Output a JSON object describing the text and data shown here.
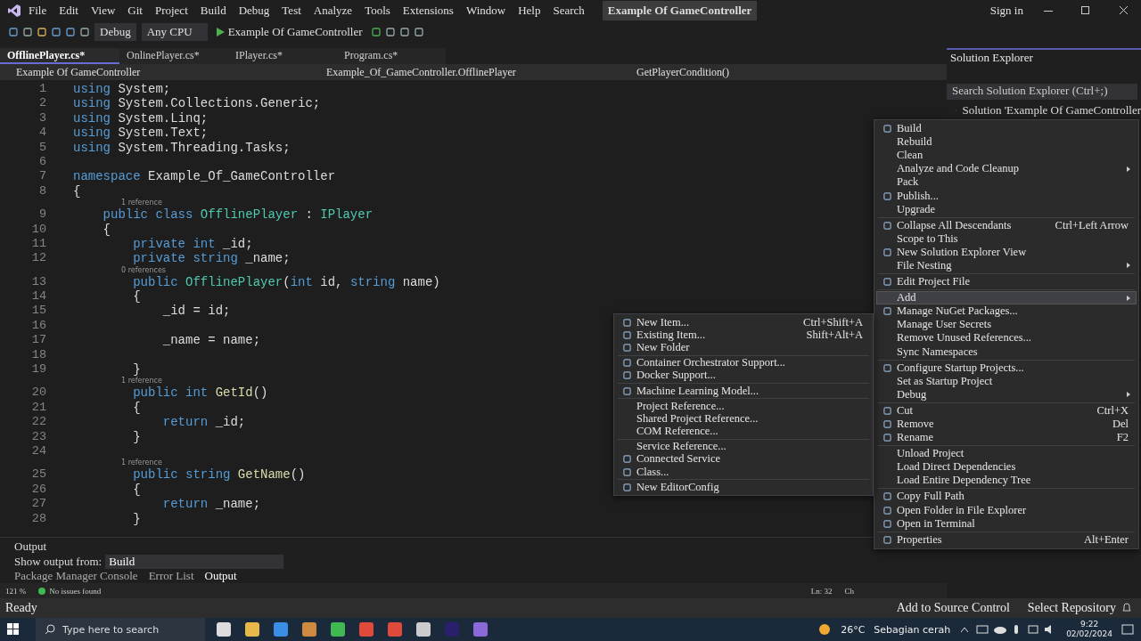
{
  "menu_bar": {
    "items": [
      "File",
      "Edit",
      "View",
      "Git",
      "Project",
      "Build",
      "Debug",
      "Test",
      "Analyze",
      "Tools",
      "Extensions",
      "Window",
      "Help"
    ],
    "search": "Search",
    "title": "Example Of GameController",
    "sign_in": "Sign in"
  },
  "toolbar": {
    "configuration": "Debug",
    "platform": "Any CPU",
    "start": "Example Of GameController"
  },
  "tabs": [
    {
      "label": "OfflinePlayer.cs*",
      "selected": true
    },
    {
      "label": "OnlinePlayer.cs*",
      "selected": false
    },
    {
      "label": "IPlayer.cs*",
      "selected": false
    },
    {
      "label": "Program.cs*",
      "selected": false
    }
  ],
  "navigation": {
    "project": "Example Of GameController",
    "type": "Example_Of_GameController.OfflinePlayer",
    "member": "GetPlayerCondition()"
  },
  "code": [
    {
      "num": "1",
      "segs": [
        {
          "kind": "keyword",
          "t": "using"
        },
        {
          "kind": "plain",
          "t": " System;"
        }
      ]
    },
    {
      "num": "2",
      "segs": [
        {
          "kind": "keyword",
          "t": "using"
        },
        {
          "kind": "plain",
          "t": " System.Collections.Generic;"
        }
      ]
    },
    {
      "num": "3",
      "segs": [
        {
          "kind": "keyword",
          "t": "using"
        },
        {
          "kind": "plain",
          "t": " System.Linq;"
        }
      ]
    },
    {
      "num": "4",
      "segs": [
        {
          "kind": "keyword",
          "t": "using"
        },
        {
          "kind": "plain",
          "t": " System.Text;"
        }
      ]
    },
    {
      "num": "5",
      "segs": [
        {
          "kind": "keyword",
          "t": "using"
        },
        {
          "kind": "plain",
          "t": " System.Threading.Tasks;"
        }
      ]
    },
    {
      "num": "6"
    },
    {
      "num": "7",
      "segs": [
        {
          "kind": "keyword",
          "t": "namespace"
        },
        {
          "kind": "plain",
          "t": " Example_Of_GameController"
        }
      ]
    },
    {
      "num": "8",
      "segs": [
        {
          "kind": "plain",
          "t": "{"
        }
      ]
    },
    {
      "num": "9",
      "lens": "1 reference",
      "segs": [
        {
          "kind": "keyword",
          "t": "    public class"
        },
        {
          "kind": "type",
          "t": " OfflinePlayer"
        },
        {
          "kind": "plain",
          "t": " : "
        },
        {
          "kind": "type",
          "t": "IPlayer"
        }
      ]
    },
    {
      "num": "10",
      "segs": [
        {
          "kind": "plain",
          "t": "    {"
        }
      ]
    },
    {
      "num": "11",
      "segs": [
        {
          "kind": "keyword",
          "t": "        private int"
        },
        {
          "kind": "plain",
          "t": " _id;"
        }
      ]
    },
    {
      "num": "12",
      "segs": [
        {
          "kind": "keyword",
          "t": "        private string"
        },
        {
          "kind": "plain",
          "t": " _name;"
        }
      ]
    },
    {
      "num": "13",
      "lens": "0 references",
      "segs": [
        {
          "kind": "keyword",
          "t": "        public"
        },
        {
          "kind": "type",
          "t": " OfflinePlayer"
        },
        {
          "kind": "plain",
          "t": "("
        },
        {
          "kind": "keyword",
          "t": "int"
        },
        {
          "kind": "plain",
          "t": " id, "
        },
        {
          "kind": "keyword",
          "t": "string"
        },
        {
          "kind": "plain",
          "t": " name)"
        }
      ]
    },
    {
      "num": "14",
      "segs": [
        {
          "kind": "plain",
          "t": "        {"
        }
      ]
    },
    {
      "num": "15",
      "segs": [
        {
          "kind": "plain",
          "t": "            _id = id;"
        }
      ]
    },
    {
      "num": "16"
    },
    {
      "num": "17",
      "segs": [
        {
          "kind": "plain",
          "t": "            _name = name;"
        }
      ]
    },
    {
      "num": "18"
    },
    {
      "num": "19",
      "segs": [
        {
          "kind": "plain",
          "t": "        }"
        }
      ]
    },
    {
      "num": "20",
      "lens": "1 reference",
      "segs": [
        {
          "kind": "keyword",
          "t": "        public int"
        },
        {
          "kind": "method",
          "t": " GetId"
        },
        {
          "kind": "plain",
          "t": "()"
        }
      ]
    },
    {
      "num": "21",
      "segs": [
        {
          "kind": "plain",
          "t": "        {"
        }
      ]
    },
    {
      "num": "22",
      "segs": [
        {
          "kind": "keyword",
          "t": "            return"
        },
        {
          "kind": "plain",
          "t": " _id;"
        }
      ]
    },
    {
      "num": "23",
      "segs": [
        {
          "kind": "plain",
          "t": "        }"
        }
      ]
    },
    {
      "num": "24"
    },
    {
      "num": "25",
      "lens": "1 reference",
      "segs": [
        {
          "kind": "keyword",
          "t": "        public string"
        },
        {
          "kind": "method",
          "t": " GetName"
        },
        {
          "kind": "plain",
          "t": "()"
        }
      ]
    },
    {
      "num": "26",
      "segs": [
        {
          "kind": "plain",
          "t": "        {"
        }
      ]
    },
    {
      "num": "27",
      "segs": [
        {
          "kind": "keyword",
          "t": "            return"
        },
        {
          "kind": "plain",
          "t": " _name;"
        }
      ]
    },
    {
      "num": "28",
      "segs": [
        {
          "kind": "plain",
          "t": "        }"
        }
      ]
    }
  ],
  "output": {
    "title": "Output",
    "show_label": "Show output from:",
    "source": "Build",
    "tabs": [
      {
        "label": "Package Manager Console",
        "selected": false
      },
      {
        "label": "Error List",
        "selected": false
      },
      {
        "label": "Output",
        "selected": true
      }
    ]
  },
  "editor_status": {
    "zoom": "121 %",
    "issues": "No issues found",
    "line": "Ln: 32",
    "column": "Ch"
  },
  "solution_explorer": {
    "title": "Solution Explorer",
    "search_placeholder": "Search Solution Explorer (Ctrl+;)",
    "root": "Solution 'Example Of GameController"
  },
  "context_menu": [
    [
      {
        "label": "Build",
        "icon": true
      },
      {
        "label": "Rebuild"
      },
      {
        "label": "Clean"
      },
      {
        "label": "Analyze and Code Cleanup",
        "submenu": true
      },
      {
        "label": "Pack"
      },
      {
        "label": "Publish...",
        "icon": true
      },
      {
        "label": "Upgrade"
      }
    ],
    [
      {
        "label": "Collapse All Descendants",
        "shortcut": "Ctrl+Left Arrow",
        "icon": true
      },
      {
        "label": "Scope to This"
      },
      {
        "label": "New Solution Explorer View",
        "icon": true
      },
      {
        "label": "File Nesting",
        "submenu": true
      }
    ],
    [
      {
        "label": "Edit Project File",
        "icon": true
      }
    ],
    [
      {
        "label": "Add",
        "submenu": true,
        "selected": true
      },
      {
        "label": "Manage NuGet Packages...",
        "icon": true
      },
      {
        "label": "Manage User Secrets"
      },
      {
        "label": "Remove Unused References..."
      },
      {
        "label": "Sync Namespaces"
      }
    ],
    [
      {
        "label": "Configure Startup Projects...",
        "icon": true
      },
      {
        "label": "Set as Startup Project"
      },
      {
        "label": "Debug",
        "submenu": true
      }
    ],
    [
      {
        "label": "Cut",
        "shortcut": "Ctrl+X",
        "icon": true
      },
      {
        "label": "Remove",
        "shortcut": "Del",
        "icon": true
      },
      {
        "label": "Rename",
        "shortcut": "F2",
        "icon": true
      }
    ],
    [
      {
        "label": "Unload Project"
      },
      {
        "label": "Load Direct Dependencies"
      },
      {
        "label": "Load Entire Dependency Tree"
      }
    ],
    [
      {
        "label": "Copy Full Path",
        "icon": true
      },
      {
        "label": "Open Folder in File Explorer",
        "icon": true
      },
      {
        "label": "Open in Terminal",
        "icon": true
      }
    ],
    [
      {
        "label": "Properties",
        "shortcut": "Alt+Enter",
        "icon": true
      }
    ]
  ],
  "add_submenu": [
    [
      {
        "label": "New Item...",
        "shortcut": "Ctrl+Shift+A",
        "icon": true
      },
      {
        "label": "Existing Item...",
        "shortcut": "Shift+Alt+A",
        "icon": true
      },
      {
        "label": "New Folder",
        "icon": true
      }
    ],
    [
      {
        "label": "Container Orchestrator Support...",
        "icon": true
      },
      {
        "label": "Docker Support...",
        "icon": true
      }
    ],
    [
      {
        "label": "Machine Learning Model...",
        "icon": true
      }
    ],
    [
      {
        "label": "Project Reference..."
      },
      {
        "label": "Shared Project Reference..."
      },
      {
        "label": "COM Reference..."
      }
    ],
    [
      {
        "label": "Service Reference..."
      },
      {
        "label": "Connected Service",
        "icon": true
      },
      {
        "label": "Class...",
        "icon": true
      }
    ],
    [
      {
        "label": "New EditorConfig",
        "icon": true
      }
    ]
  ],
  "status_bar": {
    "text": "Ready",
    "source_control": "Add to Source Control",
    "repository": "Select Repository"
  },
  "taskbar": {
    "search_placeholder": "Type here to search",
    "temperature": "26°C",
    "weather": "Sebagian cerah",
    "time": "9:22",
    "date": "02/02/2024"
  }
}
